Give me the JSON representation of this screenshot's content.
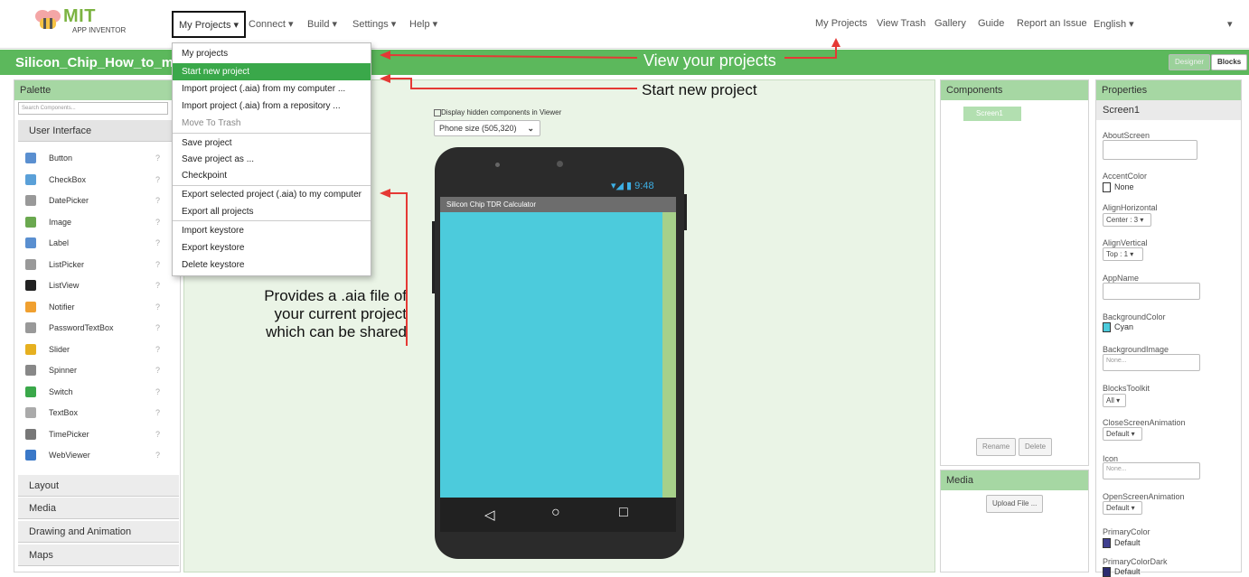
{
  "brand": {
    "mit": "MIT",
    "sub": "APP INVENTOR"
  },
  "nav": {
    "my_projects": "My Projects ▾",
    "connect": "Connect ▾",
    "build": "Build ▾",
    "settings": "Settings ▾",
    "help": "Help ▾",
    "right_my_projects": "My Projects",
    "view_trash": "View Trash",
    "gallery": "Gallery",
    "guide": "Guide",
    "report": "Report an Issue",
    "english": "English ▾",
    "caret": "▾"
  },
  "project": {
    "name": "Silicon_Chip_How_to_make",
    "designer": "Designer",
    "blocks": "Blocks"
  },
  "palette": {
    "title": "Palette",
    "search_placeholder": "Search Components...",
    "section": "User Interface",
    "items": [
      "Button",
      "CheckBox",
      "DatePicker",
      "Image",
      "Label",
      "ListPicker",
      "ListView",
      "Notifier",
      "PasswordTextBox",
      "Slider",
      "Spinner",
      "Switch",
      "TextBox",
      "TimePicker",
      "WebViewer"
    ],
    "help_glyph": "?",
    "categories": [
      "Layout",
      "Media",
      "Drawing and Animation",
      "Maps"
    ]
  },
  "menu": {
    "items": [
      "My projects",
      "Start new project",
      "Import project (.aia) from my computer ...",
      "Import project (.aia) from a repository ...",
      "Move To Trash",
      "Save project",
      "Save project as ...",
      "Checkpoint",
      "Export selected project (.aia) to my computer",
      "Export all projects",
      "Import keystore",
      "Export keystore",
      "Delete keystore"
    ]
  },
  "annotations": {
    "view": "View your projects",
    "start": "Start new project",
    "provides": [
      "Provides a .aia file of",
      "your current project",
      "which can be shared"
    ]
  },
  "viewer": {
    "display_hidden": "Display hidden components in Viewer",
    "phone_size": "Phone size (505,320)",
    "time": "9:48",
    "app_title": "Silicon Chip TDR Calculator",
    "nav_back": "◁",
    "nav_home": "○",
    "nav_recent": "□"
  },
  "components": {
    "title": "Components",
    "screen": "Screen1",
    "rename": "Rename",
    "delete": "Delete"
  },
  "media": {
    "title": "Media",
    "upload": "Upload File ..."
  },
  "properties": {
    "title": "Properties",
    "screen": "Screen1",
    "about": "AboutScreen",
    "accent": "AccentColor",
    "accent_val": "None",
    "alignh": "AlignHorizontal",
    "alignh_val": "Center : 3 ▾",
    "alignv": "AlignVertical",
    "alignv_val": "Top : 1 ▾",
    "appname": "AppName",
    "bgcolor": "BackgroundColor",
    "bgcolor_val": "Cyan",
    "bgimage": "BackgroundImage",
    "bgimage_val": "None...",
    "blocks": "BlocksToolkit",
    "blocks_val": "All ▾",
    "close": "CloseScreenAnimation",
    "close_val": "Default ▾",
    "icon": "Icon",
    "icon_val": "None...",
    "open": "OpenScreenAnimation",
    "open_val": "Default ▾",
    "primary": "PrimaryColor",
    "primary_val": "Default",
    "primarydark": "PrimaryColorDark",
    "primarydark_val": "Default"
  },
  "colors": {
    "green": "#5cb85c",
    "cyan": "#4ccbdc",
    "arrow": "#e53935"
  }
}
